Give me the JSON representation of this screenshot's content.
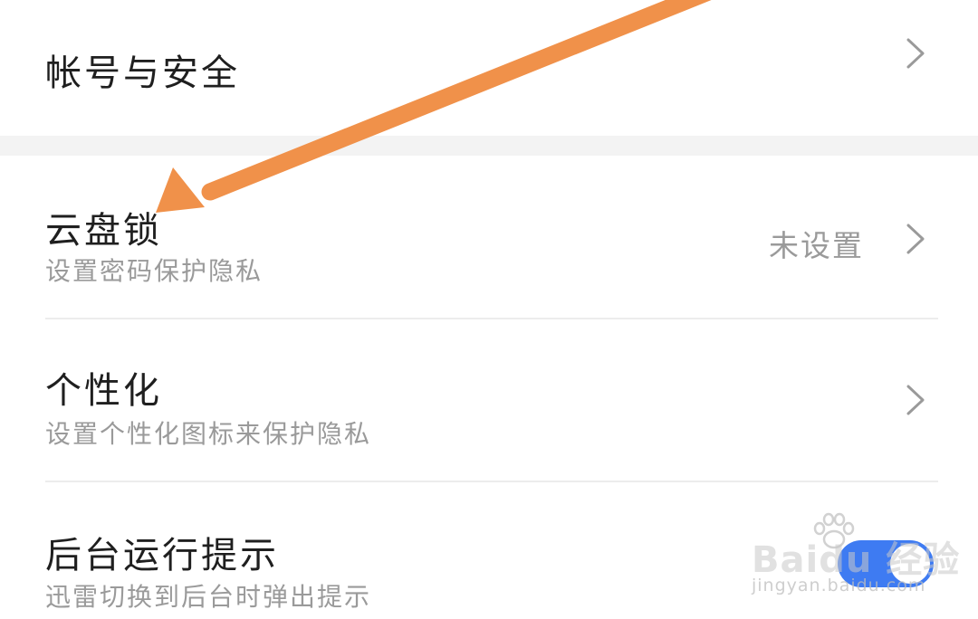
{
  "settings": {
    "items": [
      {
        "title": "帐号与安全",
        "subtitle": "",
        "value": ""
      },
      {
        "title": "云盘锁",
        "subtitle": "设置密码保护隐私",
        "value": "未设置"
      },
      {
        "title": "个性化",
        "subtitle": "设置个性化图标来保护隐私",
        "value": ""
      },
      {
        "title": "后台运行提示",
        "subtitle": "迅雷切换到后台时弹出提示",
        "value": ""
      }
    ],
    "background_run_toggle": {
      "state": "on"
    }
  },
  "icons": {
    "chevron": "chevron-right-icon",
    "annotation": "arrow-annotation-icon"
  },
  "colors": {
    "toggle_on": "#3e7bf2",
    "annotation_arrow": "#f0914a",
    "title_text": "#1f1f1f",
    "secondary_text": "#9a9a9a",
    "section_gap": "#f3f3f3"
  },
  "watermark": {
    "brand": "Baidu 经验",
    "url": "jingyan.baidu.com"
  }
}
